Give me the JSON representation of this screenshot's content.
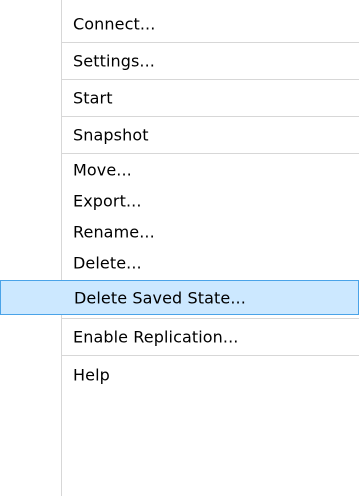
{
  "menu": {
    "items": [
      {
        "label": "Connect..."
      },
      {
        "label": "Settings..."
      },
      {
        "label": "Start"
      },
      {
        "label": "Snapshot"
      },
      {
        "label": "Move..."
      },
      {
        "label": "Export..."
      },
      {
        "label": "Rename..."
      },
      {
        "label": "Delete..."
      },
      {
        "label": "Delete Saved State...",
        "state": "highlighted"
      },
      {
        "label": "Enable Replication..."
      },
      {
        "label": "Help"
      }
    ],
    "colors": {
      "highlight_fill": "#cce8ff",
      "highlight_border": "#4aa3e8",
      "separator": "#d7d7d7"
    }
  }
}
